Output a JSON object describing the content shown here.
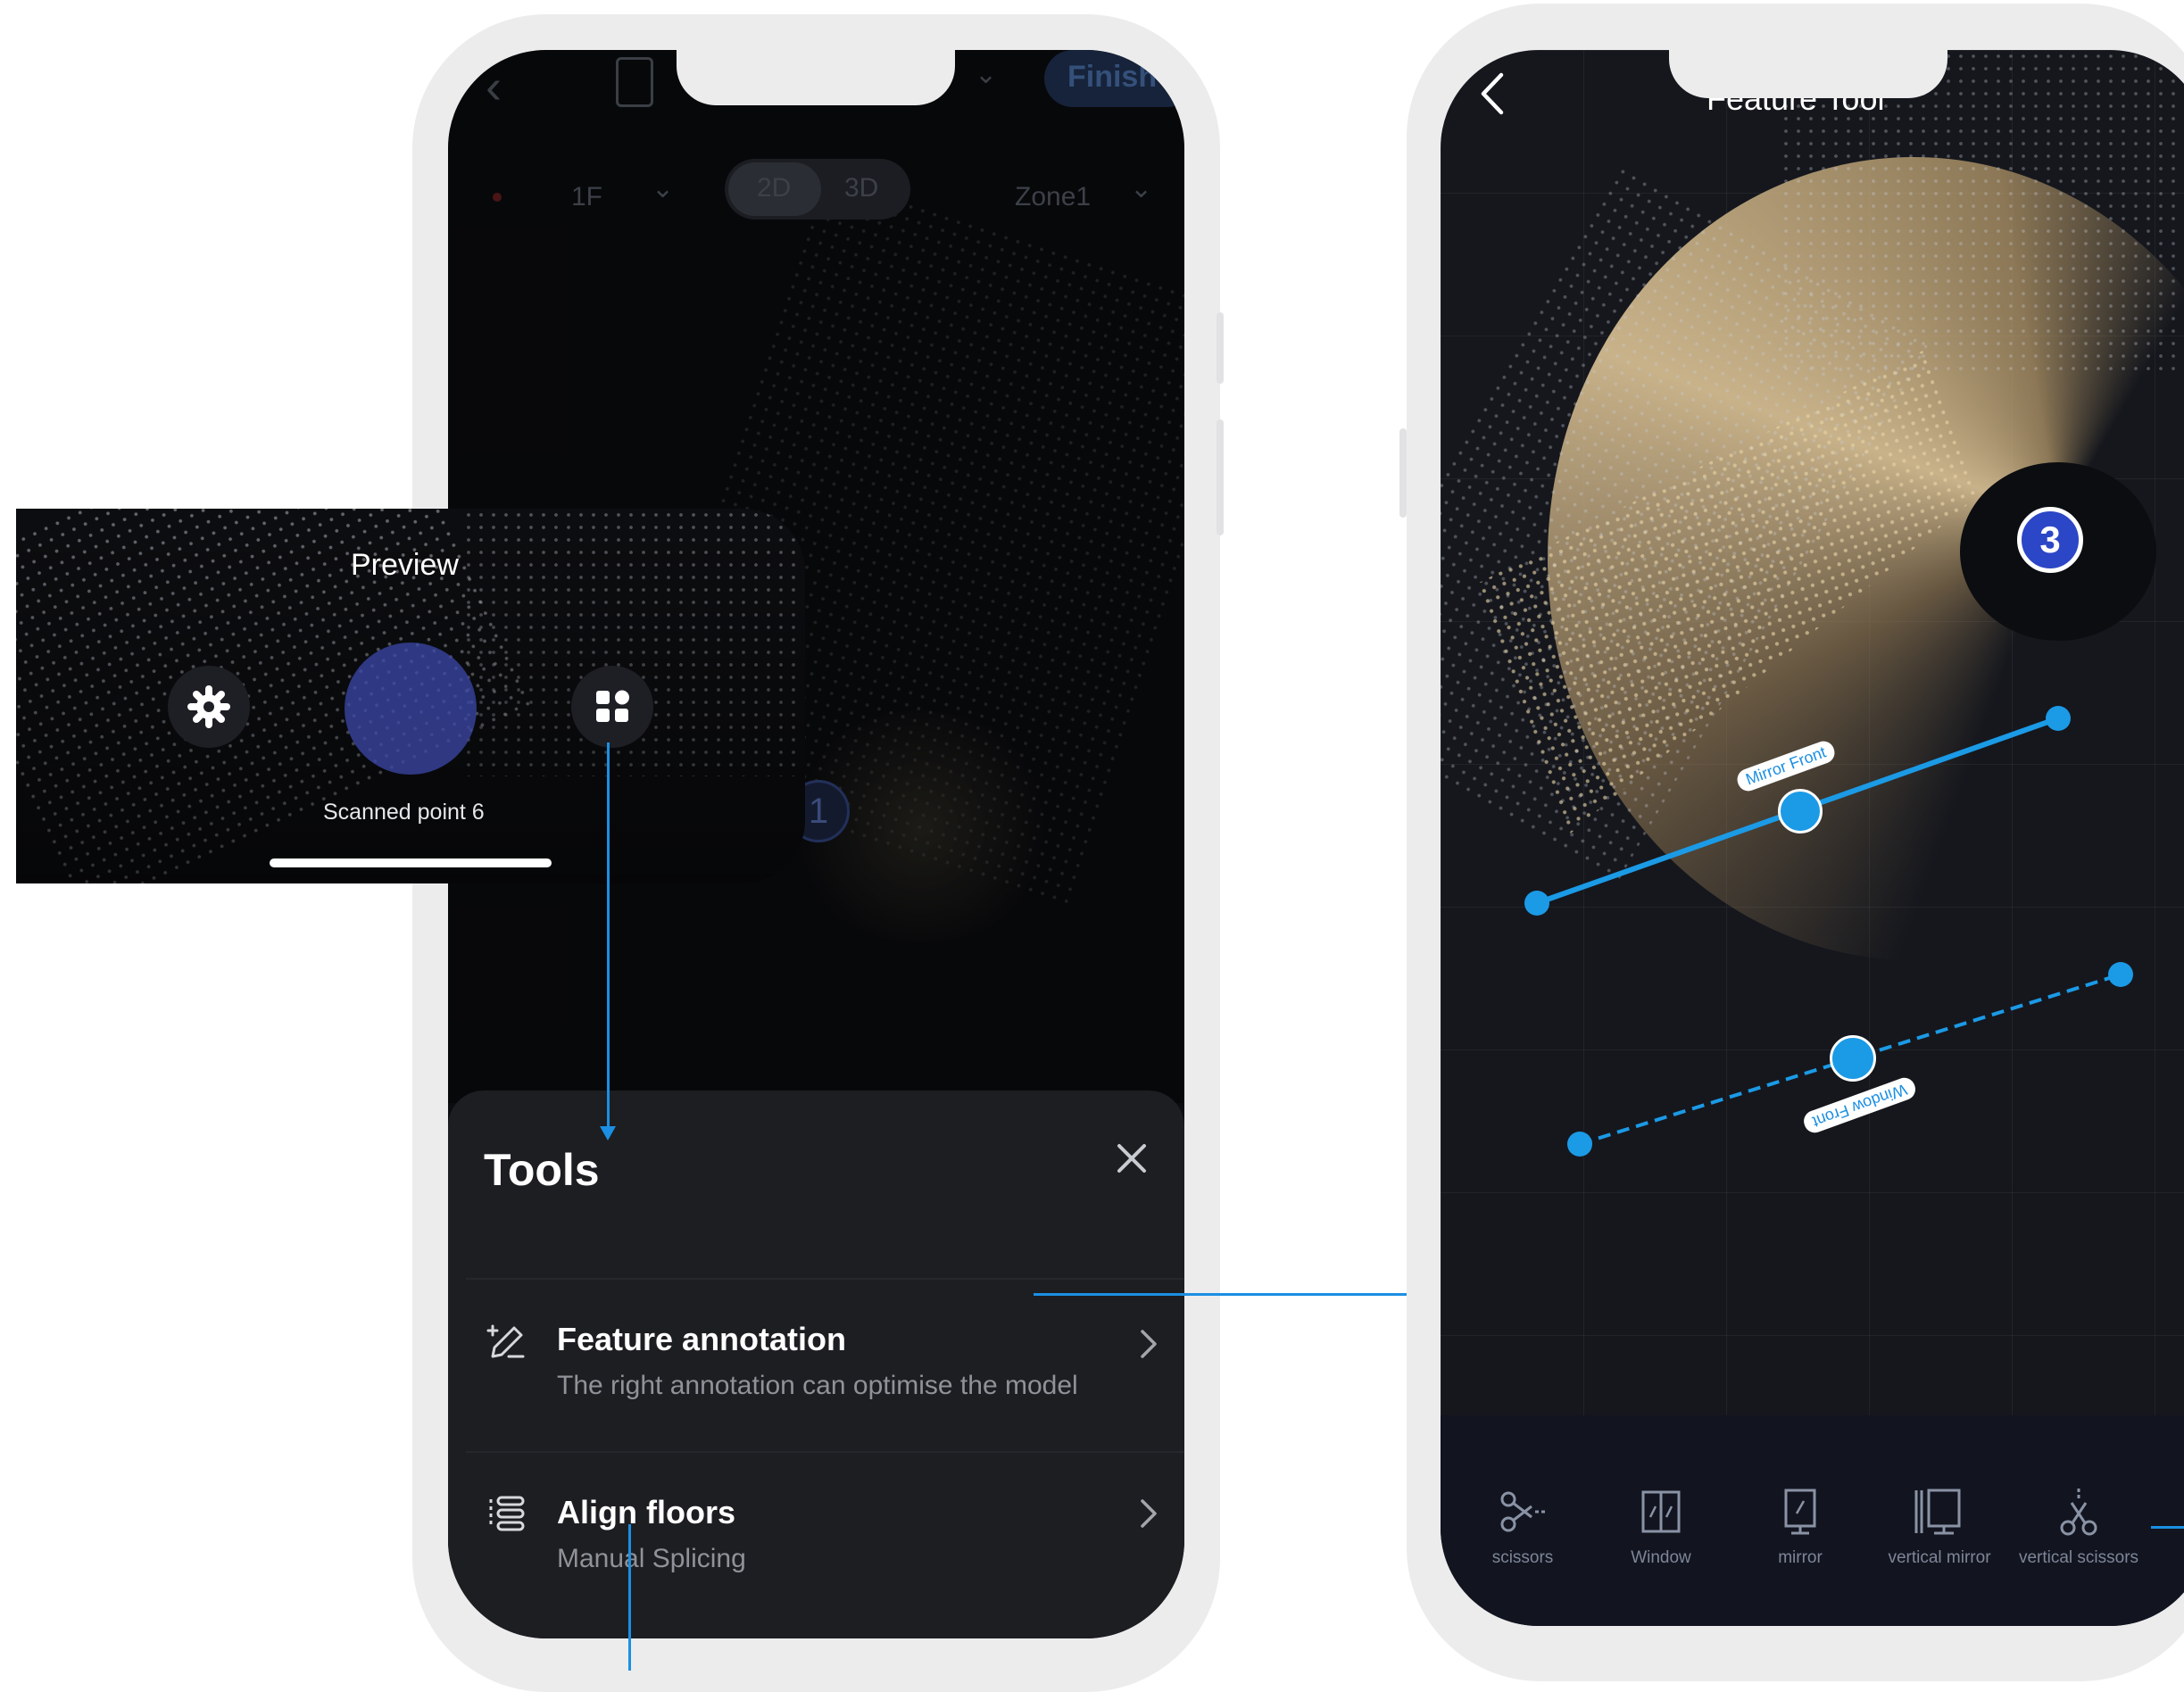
{
  "phone1": {
    "finish_button": "Finish",
    "floor_select": "1F",
    "view_2d": "2D",
    "view_3d": "3D",
    "zone_select": "Zone1",
    "marker_number": "1"
  },
  "preview": {
    "title": "Preview",
    "status": "Scanned point 6"
  },
  "tools_sheet": {
    "title": "Tools",
    "items": [
      {
        "title": "Feature annotation",
        "subtitle": "The right annotation can optimise the model"
      },
      {
        "title": "Align floors",
        "subtitle": "Manual Splicing"
      }
    ]
  },
  "phone2": {
    "title": "Feature Tool",
    "marker_number": "3",
    "annotations": {
      "mirror": "Mirror Front",
      "window": "Window Front"
    },
    "toolbar": [
      {
        "label": "scissors",
        "icon": "scissors-icon"
      },
      {
        "label": "Window",
        "icon": "window-icon"
      },
      {
        "label": "mirror",
        "icon": "mirror-icon"
      },
      {
        "label": "vertical mirror",
        "icon": "vertical-mirror-icon"
      },
      {
        "label": "vertical scissors",
        "icon": "vertical-scissors-icon"
      }
    ]
  },
  "colors": {
    "accent": "#1b8fe3",
    "sheet_bg": "#1d1e22",
    "frame": "#ececed"
  }
}
